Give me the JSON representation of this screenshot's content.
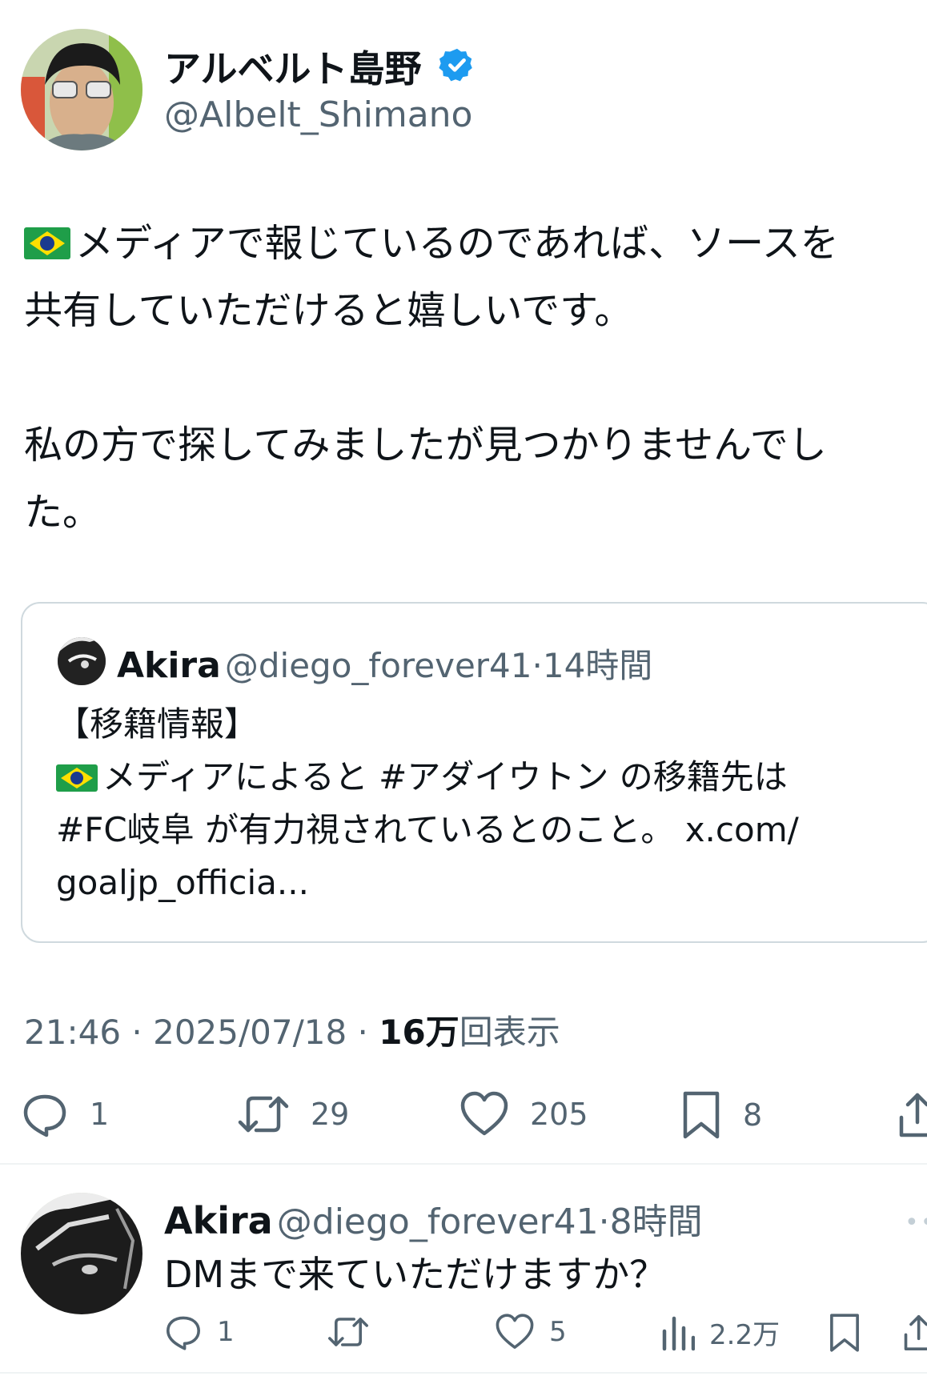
{
  "main_tweet": {
    "author_name": "アルベルト島野",
    "author_handle": "@Albelt_Shimano",
    "verified_icon": "verified-badge-icon",
    "paragraph1_line1": "メディアで報じているのであれば、ソースを",
    "paragraph1_line2": "共有していただけると嬉しいです。",
    "paragraph2_line1": "私の方で探してみましたが見つかりませんでし",
    "paragraph2_line2": "た。",
    "time": "21:46",
    "date": "2025/07/18",
    "views_count": "16万",
    "views_label": "回表示",
    "replies": "1",
    "reposts": "29",
    "likes": "205",
    "bookmarks": "8"
  },
  "quoted_tweet": {
    "author_name": "Akira",
    "author_handle": "@diego_forever41",
    "age": "14時間",
    "line1": "【移籍情報】",
    "line2": "メディアによると #アダイウトン の移籍先は",
    "line3": "#FC岐阜 が有力視されているとのこと。 x.com/",
    "line4": "goaljp_officia..."
  },
  "reply": {
    "author_name": "Akira",
    "author_handle": "@diego_forever41",
    "age": "8時間",
    "text": "DMまで来ていただけますか？",
    "replies": "1",
    "likes": "5",
    "views": "2.2万"
  },
  "colors": {
    "text": "#0f1419",
    "secondary": "#536471",
    "verified": "#1d9bf0",
    "border": "#cfd9de"
  }
}
